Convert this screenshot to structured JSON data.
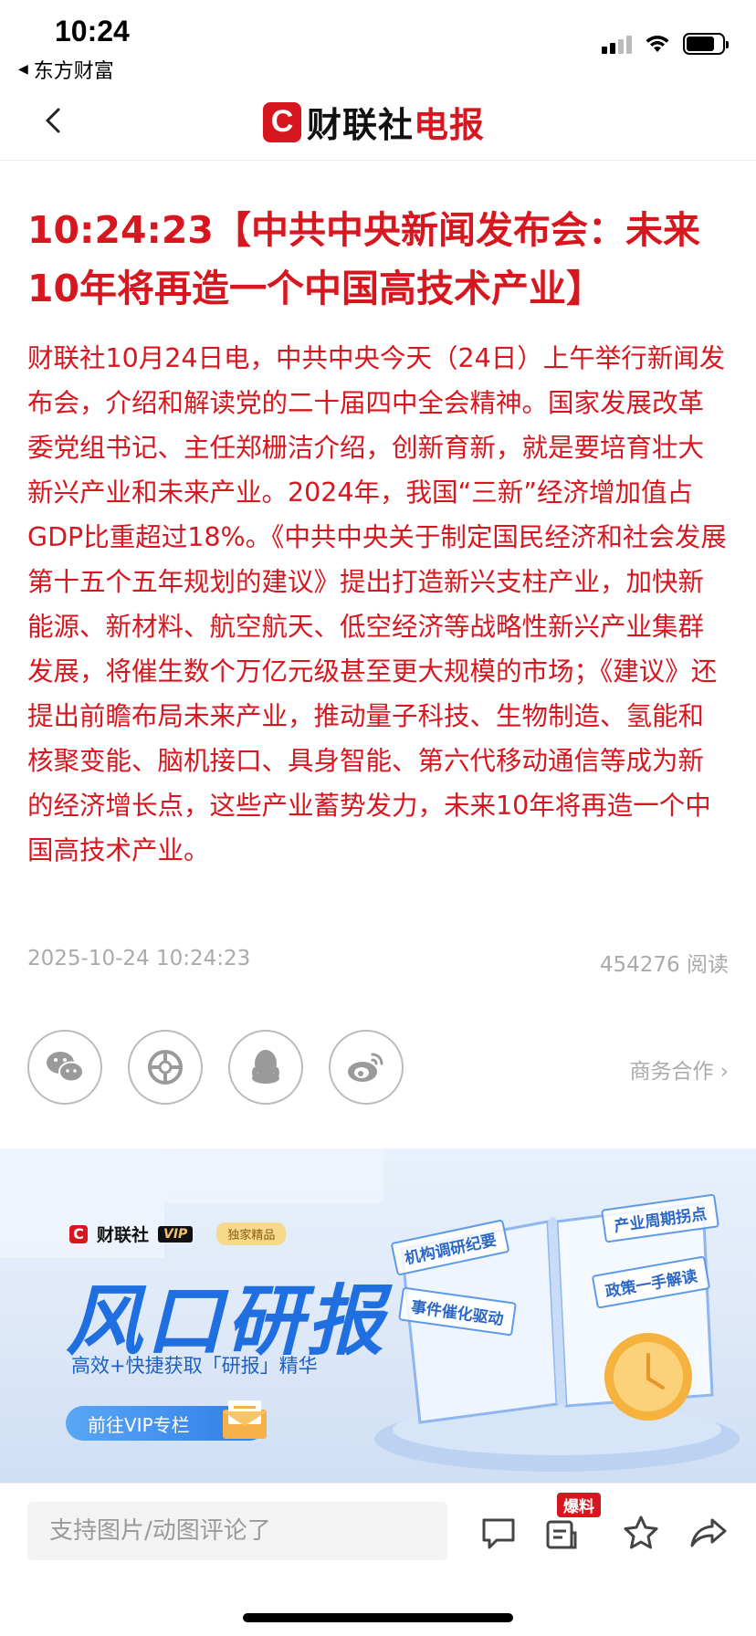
{
  "status_bar": {
    "time": "10:24",
    "back_app": "东方财富"
  },
  "nav": {
    "logo_letter": "C",
    "logo_black": "财联社",
    "logo_red": "电报"
  },
  "article": {
    "headline": "10:24:23【中共中央新闻发布会：未来10年将再造一个中国高技术产业】",
    "body": "财联社10月24日电，中共中央今天（24日）上午举行新闻发布会，介绍和解读党的二十届四中全会精神。国家发展改革委党组书记、主任郑栅洁介绍，创新育新，就是要培育壮大新兴产业和未来产业。2024年，我国“三新”经济增加值占GDP比重超过18%。《中共中央关于制定国民经济和社会发展第十五个五年规划的建议》提出打造新兴支柱产业，加快新能源、新材料、航空航天、低空经济等战略性新兴产业集群发展，将催生数个万亿元级甚至更大规模的市场；《建议》还提出前瞻布局未来产业，推动量子科技、生物制造、氢能和核聚变能、脑机接口、具身智能、第六代移动通信等成为新的经济增长点，这些产业蓄势发力，未来10年将再造一个中国高技术产业。",
    "date": "2025-10-24 10:24:23",
    "reads": "454276 阅读"
  },
  "share": {
    "icons": [
      "wechat-icon",
      "moments-icon",
      "qq-icon",
      "weibo-icon"
    ],
    "biz_link": "商务合作 ›"
  },
  "banner": {
    "brand_letter": "C",
    "brand": "财联社",
    "vip": "VIP",
    "tag": "独家精品",
    "title": "风口研报",
    "subtitle": "高效+快捷获取「研报」精华",
    "cta": "前往VIP专栏",
    "chips": [
      "机构调研纪要",
      "事件催化驱动",
      "产业周期拐点",
      "政策一手解读"
    ]
  },
  "bottom_bar": {
    "comment_placeholder": "支持图片/动图评论了",
    "badge": "爆料"
  },
  "colors": {
    "accent": "#d7171f",
    "banner_blue": "#1f6fe0"
  }
}
